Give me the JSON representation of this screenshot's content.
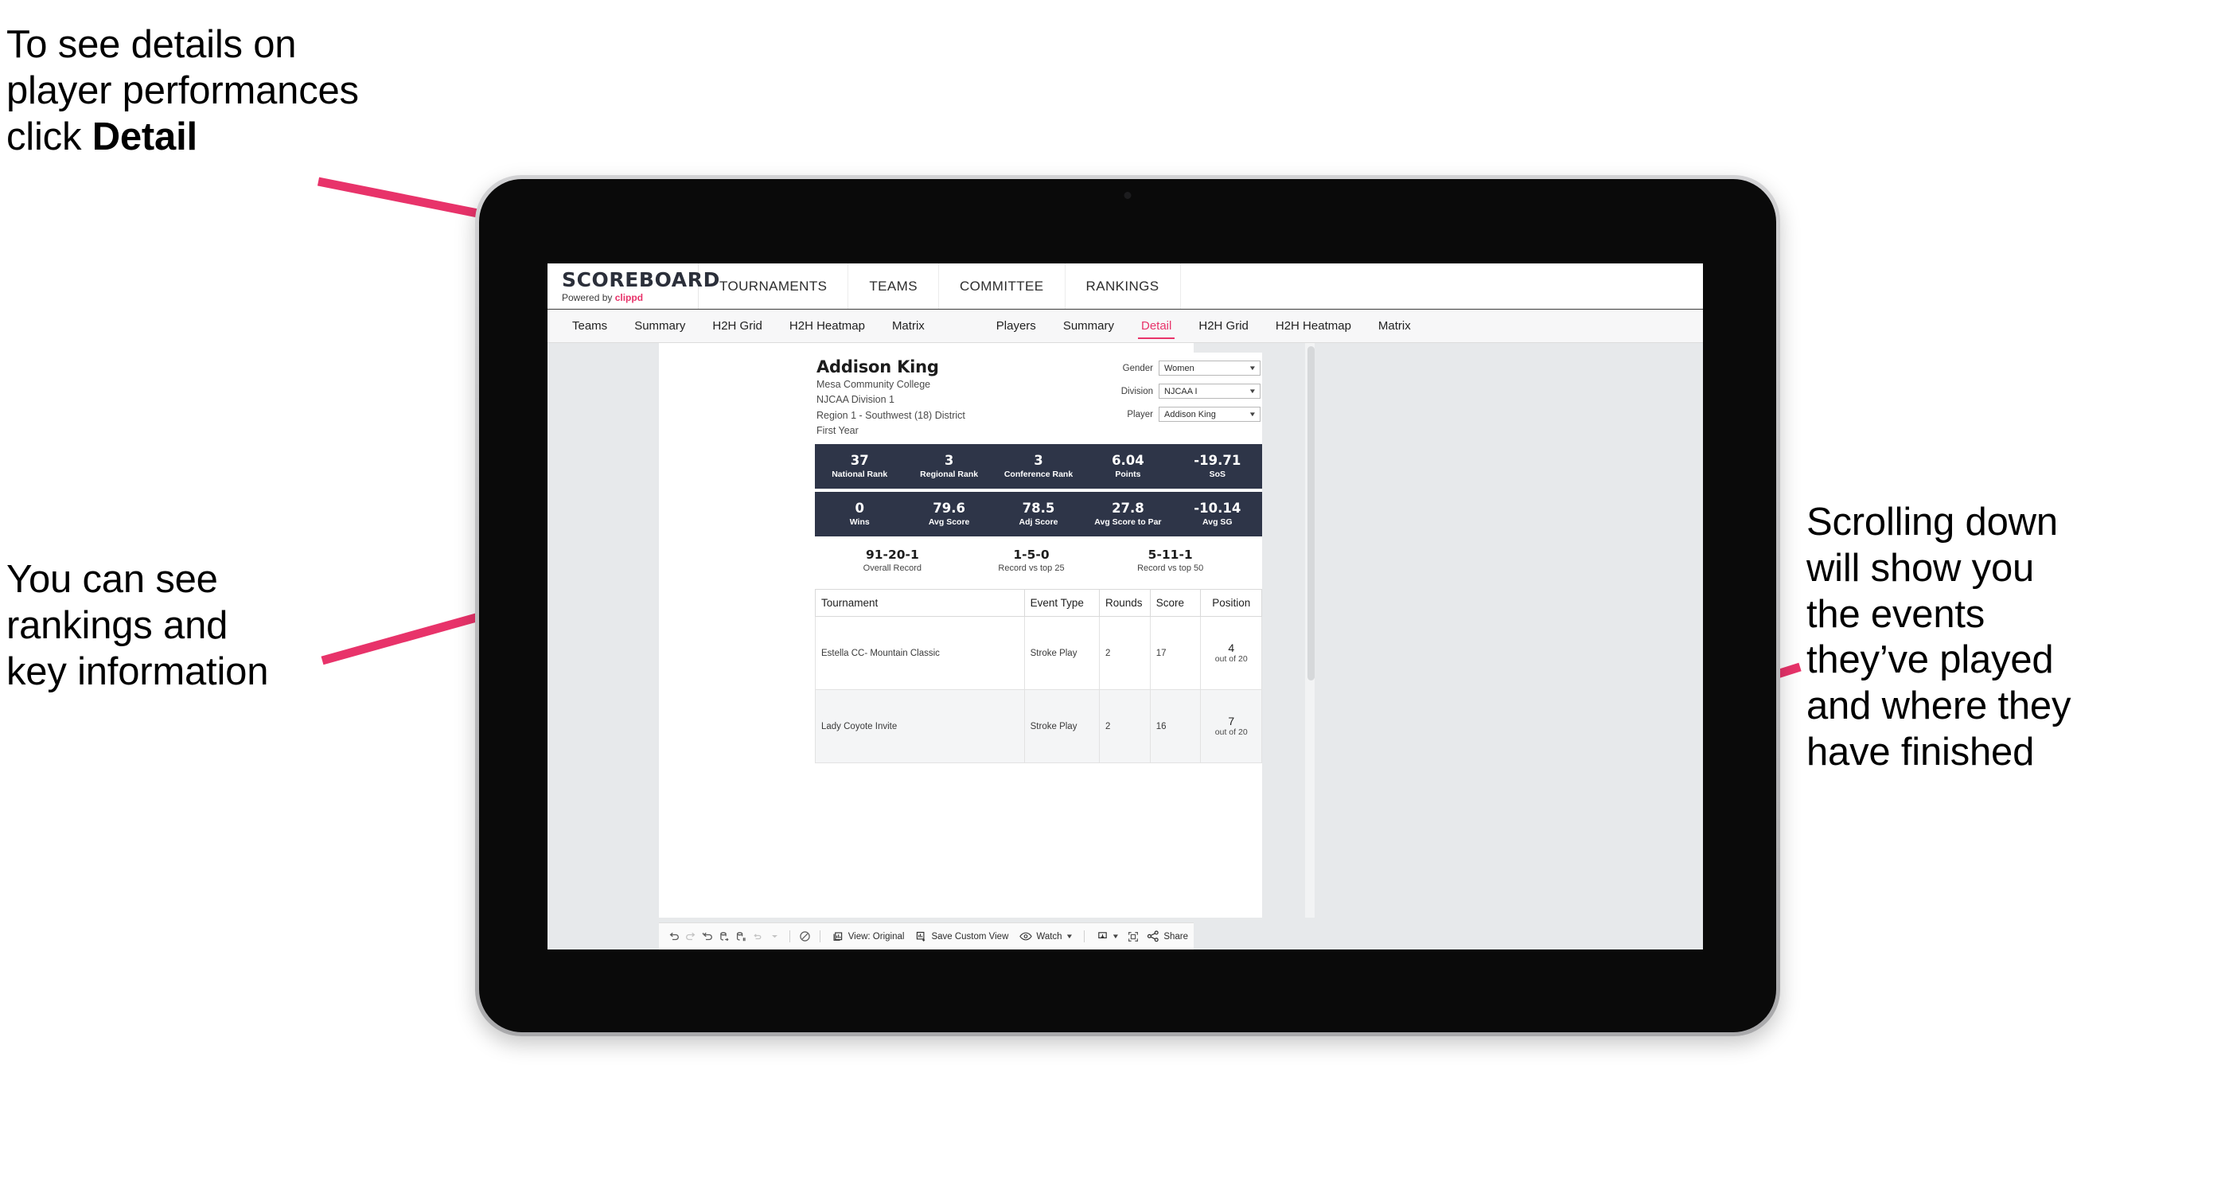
{
  "annotations": {
    "top_left": {
      "line1": "To see details on",
      "line2": "player performances",
      "line3_prefix": "click ",
      "line3_bold": "Detail"
    },
    "mid_left": "You can see\nrankings and\nkey information",
    "right": "Scrolling down\nwill show you\nthe events\nthey’ve played\nand where they\nhave finished",
    "accent_color": "#e8336a"
  },
  "app": {
    "brand": {
      "title": "SCOREBOARD",
      "powered_prefix": "Powered by ",
      "powered_brand": "clippd"
    },
    "topnav": [
      "TOURNAMENTS",
      "TEAMS",
      "COMMITTEE",
      "RANKINGS"
    ],
    "tabs_group_teams": [
      {
        "label": "Teams",
        "active": false
      },
      {
        "label": "Summary",
        "active": false
      },
      {
        "label": "H2H Grid",
        "active": false
      },
      {
        "label": "H2H Heatmap",
        "active": false
      },
      {
        "label": "Matrix",
        "active": false
      }
    ],
    "tabs_group_players": [
      {
        "label": "Players",
        "active": false
      },
      {
        "label": "Summary",
        "active": false
      },
      {
        "label": "Detail",
        "active": true
      },
      {
        "label": "H2H Grid",
        "active": false
      },
      {
        "label": "H2H Heatmap",
        "active": false
      },
      {
        "label": "Matrix",
        "active": false
      }
    ],
    "player": {
      "name": "Addison King",
      "school": "Mesa Community College",
      "division": "NJCAA Division 1",
      "region": "Region 1 - Southwest (18) District",
      "year": "First Year"
    },
    "filters": [
      {
        "label": "Gender",
        "value": "Women"
      },
      {
        "label": "Division",
        "value": "NJCAA I"
      },
      {
        "label": "Player",
        "value": "Addison King"
      }
    ],
    "stats_row1": [
      {
        "value": "37",
        "label": "National Rank"
      },
      {
        "value": "3",
        "label": "Regional Rank"
      },
      {
        "value": "3",
        "label": "Conference Rank"
      },
      {
        "value": "6.04",
        "label": "Points"
      },
      {
        "value": "-19.71",
        "label": "SoS"
      }
    ],
    "stats_row2": [
      {
        "value": "0",
        "label": "Wins"
      },
      {
        "value": "79.6",
        "label": "Avg Score"
      },
      {
        "value": "78.5",
        "label": "Adj Score"
      },
      {
        "value": "27.8",
        "label": "Avg Score to Par"
      },
      {
        "value": "-10.14",
        "label": "Avg SG"
      }
    ],
    "records": [
      {
        "value": "91-20-1",
        "label": "Overall Record"
      },
      {
        "value": "1-5-0",
        "label": "Record vs top 25"
      },
      {
        "value": "5-11-1",
        "label": "Record vs top 50"
      }
    ],
    "events_table": {
      "headers": [
        "Tournament",
        "Event Type",
        "Rounds",
        "Score",
        "Position"
      ],
      "rows": [
        {
          "tournament": "Estella CC- Mountain Classic",
          "event_type": "Stroke Play",
          "rounds": "2",
          "score": "17",
          "position": "4",
          "position_of": "out of 20"
        },
        {
          "tournament": "Lady Coyote Invite",
          "event_type": "Stroke Play",
          "rounds": "2",
          "score": "16",
          "position": "7",
          "position_of": "out of 20"
        }
      ]
    },
    "toolbar": {
      "view_label": "View: Original",
      "save_label": "Save Custom View",
      "watch_label": "Watch",
      "share_label": "Share"
    }
  }
}
